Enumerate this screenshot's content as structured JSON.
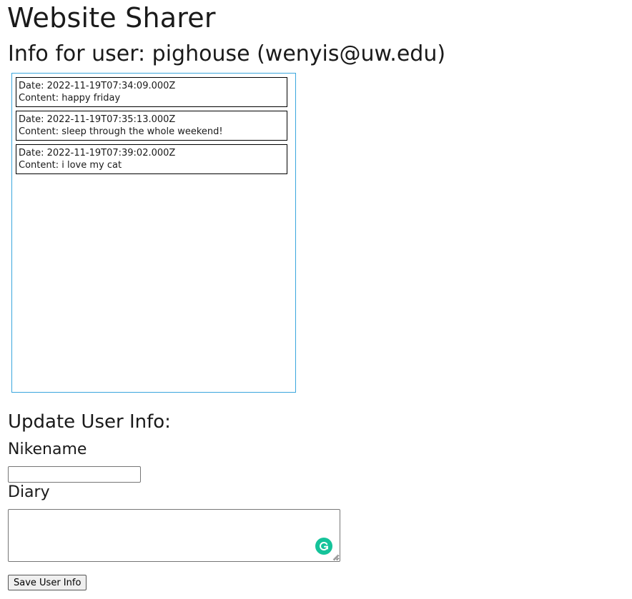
{
  "app": {
    "title": "Website Sharer"
  },
  "user_info": {
    "heading": "Info for user: pighouse (wenyis@uw.edu)"
  },
  "posts": [
    {
      "date": "Date: 2022-11-19T07:34:09.000Z",
      "content": "Content: happy friday"
    },
    {
      "date": "Date: 2022-11-19T07:35:13.000Z",
      "content": "Content: sleep through the whole weekend!"
    },
    {
      "date": "Date: 2022-11-19T07:39:02.000Z",
      "content": "Content: i love my cat"
    }
  ],
  "update_form": {
    "heading": "Update User Info:",
    "nickname_label": "Nikename",
    "nickname_value": "",
    "diary_label": "Diary",
    "diary_value": "",
    "save_label": "Save User Info"
  },
  "icons": {
    "grammar_icon": "grammarly-icon",
    "grammar_icon_color": "#15c39a",
    "panel_border_color": "#3aa6dd"
  }
}
